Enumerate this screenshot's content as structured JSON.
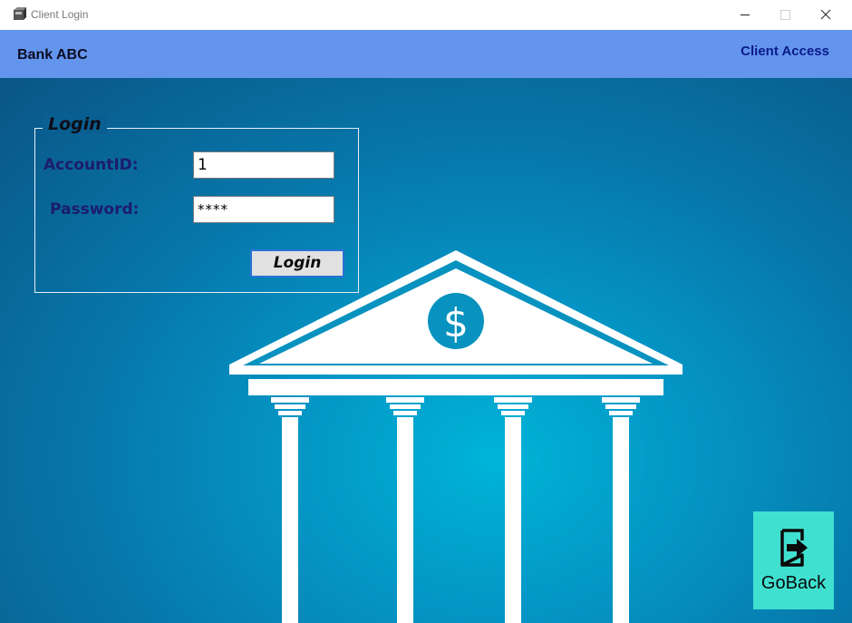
{
  "window": {
    "title": "Client Login",
    "icons": {
      "app": "app-icon",
      "minimize": "minimize-icon",
      "maximize": "maximize-icon",
      "close": "close-icon"
    }
  },
  "header": {
    "bank_name": "Bank ABC",
    "client_access": "Client Access",
    "background_color": "#6495ed"
  },
  "login": {
    "legend": "Login",
    "account_label": "AccountID:",
    "account_value": "1",
    "password_label": "Password:",
    "password_value": "****",
    "button_label": "Login"
  },
  "goback": {
    "label": "GoBack",
    "icon": "exit-arrow-icon",
    "background_color": "#40e0d0"
  },
  "background": {
    "illustration": "bank-building-with-dollar-sign",
    "accent_color": "#00b4d8"
  }
}
